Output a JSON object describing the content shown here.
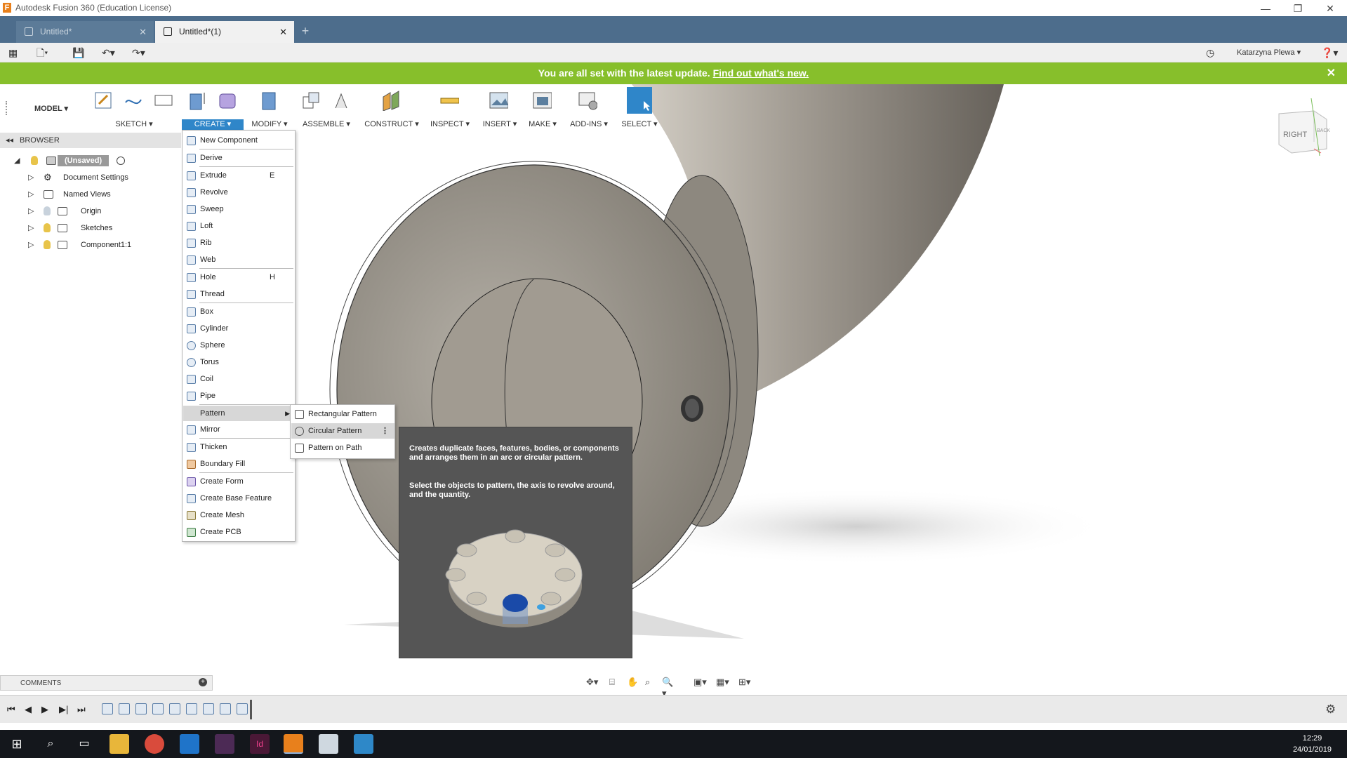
{
  "app": {
    "window_title": "Autodesk Fusion 360 (Education License)",
    "logo": "F"
  },
  "tabs": [
    {
      "label": "Untitled*",
      "active": false
    },
    {
      "label": "Untitled*(1)",
      "active": true
    }
  ],
  "quickbar": {
    "user": "Katarzyna Plewa ▾"
  },
  "banner": {
    "message": "You are all set with the latest update.",
    "link": "Find out what's new."
  },
  "ribbon": {
    "workspace": "MODEL ▾",
    "groups": [
      "SKETCH ▾",
      "CREATE ▾",
      "MODIFY ▾",
      "ASSEMBLE ▾",
      "CONSTRUCT ▾",
      "INSPECT ▾",
      "INSERT ▾",
      "MAKE ▾",
      "ADD-INS ▾",
      "SELECT ▾"
    ]
  },
  "browser": {
    "header": "BROWSER",
    "items": [
      {
        "label": "(Unsaved)"
      },
      {
        "label": "Document Settings"
      },
      {
        "label": "Named Views"
      },
      {
        "label": "Origin"
      },
      {
        "label": "Sketches"
      },
      {
        "label": "Component1:1"
      }
    ]
  },
  "create_menu": {
    "items": [
      {
        "label": "New Component",
        "key": ""
      },
      {
        "label": "Derive",
        "key": ""
      },
      {
        "label": "Extrude",
        "key": "E"
      },
      {
        "label": "Revolve",
        "key": ""
      },
      {
        "label": "Sweep",
        "key": ""
      },
      {
        "label": "Loft",
        "key": ""
      },
      {
        "label": "Rib",
        "key": ""
      },
      {
        "label": "Web",
        "key": ""
      },
      {
        "label": "Hole",
        "key": "H"
      },
      {
        "label": "Thread",
        "key": ""
      },
      {
        "label": "Box",
        "key": ""
      },
      {
        "label": "Cylinder",
        "key": ""
      },
      {
        "label": "Sphere",
        "key": ""
      },
      {
        "label": "Torus",
        "key": ""
      },
      {
        "label": "Coil",
        "key": ""
      },
      {
        "label": "Pipe",
        "key": ""
      },
      {
        "label": "Pattern",
        "key": ""
      },
      {
        "label": "Mirror",
        "key": ""
      },
      {
        "label": "Thicken",
        "key": ""
      },
      {
        "label": "Boundary Fill",
        "key": ""
      },
      {
        "label": "Create Form",
        "key": ""
      },
      {
        "label": "Create Base Feature",
        "key": ""
      },
      {
        "label": "Create Mesh",
        "key": ""
      },
      {
        "label": "Create PCB",
        "key": ""
      }
    ]
  },
  "pattern_submenu": {
    "items": [
      "Rectangular Pattern",
      "Circular Pattern",
      "Pattern on Path"
    ]
  },
  "tooltip": {
    "line1": "Creates duplicate faces, features, bodies, or components and arranges them in an arc or circular pattern.",
    "line2": "Select the objects to pattern, the axis to revolve around, and the quantity."
  },
  "viewcube": {
    "face_label": "RIGHT",
    "side_label": "BACK"
  },
  "comments": {
    "label": "COMMENTS"
  },
  "taskbar": {
    "time": "12:29",
    "date": "24/01/2019"
  },
  "colors": {
    "accent": "#2f86c9",
    "banner": "#87bf2b",
    "tabbar": "#4d6d8c"
  }
}
